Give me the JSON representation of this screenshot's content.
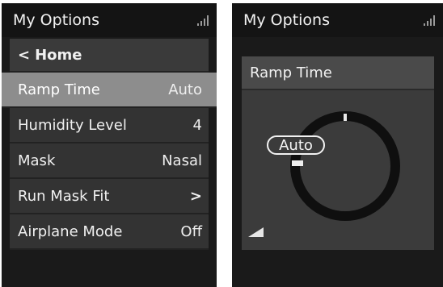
{
  "left_screen": {
    "title": "My Options",
    "home": {
      "label": "Home"
    },
    "items": [
      {
        "label": "Ramp Time",
        "value": "Auto"
      },
      {
        "label": "Humidity Level",
        "value": "4"
      },
      {
        "label": "Mask",
        "value": "Nasal"
      },
      {
        "label": "Run Mask Fit",
        "value": ""
      },
      {
        "label": "Airplane Mode",
        "value": "Off"
      }
    ]
  },
  "right_screen": {
    "title": "My Options",
    "panel_title": "Ramp Time",
    "dial_value": "Auto"
  },
  "colors": {
    "screen_bg": "#1a1a1a",
    "row_bg": "#333333",
    "selected_row_bg": "#8d8d8d",
    "panel_bg": "#3b3b3b"
  },
  "icons": [
    "signal-icon",
    "chevron-left-icon",
    "chevron-right-icon",
    "ramp-icon"
  ]
}
